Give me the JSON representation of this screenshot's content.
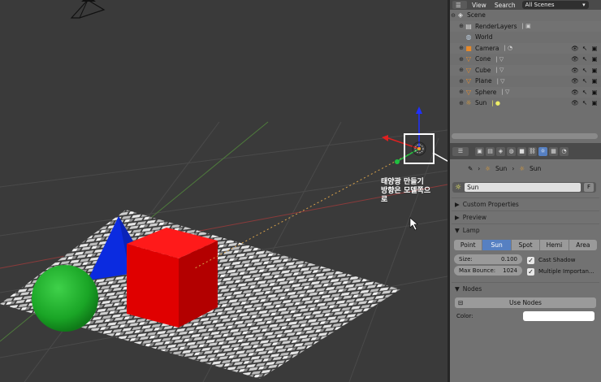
{
  "outliner": {
    "header": {
      "view_label": "View",
      "search_label": "Search",
      "scene_select": "All Scenes"
    },
    "items": [
      {
        "label": "Scene",
        "icon": "scene-icon"
      },
      {
        "label": "RenderLayers",
        "icon": "render-layers-icon"
      },
      {
        "label": "World",
        "icon": "world-icon"
      },
      {
        "label": "Camera",
        "icon": "camera-icon"
      },
      {
        "label": "Cone",
        "icon": "mesh-icon"
      },
      {
        "label": "Cube",
        "icon": "mesh-icon"
      },
      {
        "label": "Plane",
        "icon": "mesh-icon"
      },
      {
        "label": "Sphere",
        "icon": "mesh-icon"
      },
      {
        "label": "Sun",
        "icon": "lamp-icon"
      }
    ]
  },
  "properties": {
    "breadcrumb": {
      "object": "Sun",
      "data": "Sun"
    },
    "lamp_name": "Sun",
    "fake_user": "F",
    "panels": {
      "custom_properties": "Custom Properties",
      "preview": "Preview",
      "lamp": "Lamp",
      "nodes": "Nodes"
    },
    "lamp_types": [
      "Point",
      "Sun",
      "Spot",
      "Hemi",
      "Area"
    ],
    "active_lamp_type": "Sun",
    "size_label": "Size:",
    "size_value": "0.100",
    "max_bounce_label": "Max Bounce:",
    "max_bounce_value": "1024",
    "cast_shadow": "Cast Shadow",
    "multiple_importance": "Multiple Importan...",
    "use_nodes": "Use Nodes",
    "color_label": "Color:"
  },
  "viewport": {
    "annotation_line1": "태양광 만들기",
    "annotation_line2": "방향은 모델쪽으",
    "annotation_line3": "로"
  },
  "colors": {
    "accent": "#5680c2",
    "cube": "#e00000",
    "sphere": "#1fae2a",
    "cone": "#0b2be0"
  }
}
